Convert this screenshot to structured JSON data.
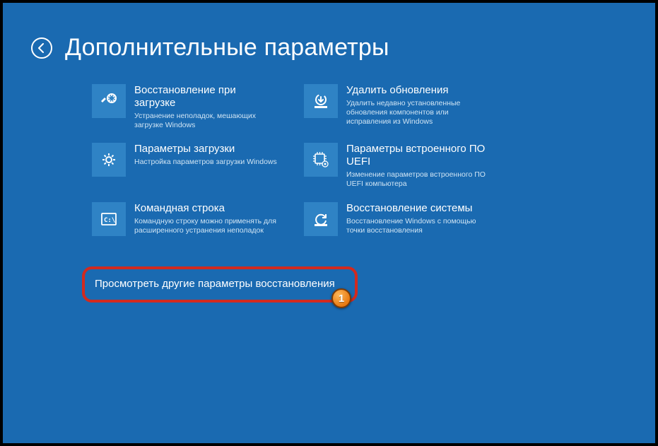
{
  "header": {
    "title": "Дополнительные параметры"
  },
  "tiles": [
    {
      "title": "Восстановление при загрузке",
      "desc": "Устранение неполадок, мешающих загрузке Windows"
    },
    {
      "title": "Удалить обновления",
      "desc": "Удалить недавно установленные обновления компонентов или исправления из Windows"
    },
    {
      "title": "Параметры загрузки",
      "desc": "Настройка параметров загрузки Windows"
    },
    {
      "title": "Параметры встроенного ПО UEFI",
      "desc": "Изменение параметров встроенного ПО UEFI компьютера"
    },
    {
      "title": "Командная строка",
      "desc": "Командную строку можно применять для расширенного устранения неполадок"
    },
    {
      "title": "Восстановление системы",
      "desc": "Восстановление Windows с помощью точки восстановления"
    }
  ],
  "more": {
    "label": "Просмотреть другие параметры восстановления"
  },
  "callout": {
    "number": "1"
  }
}
